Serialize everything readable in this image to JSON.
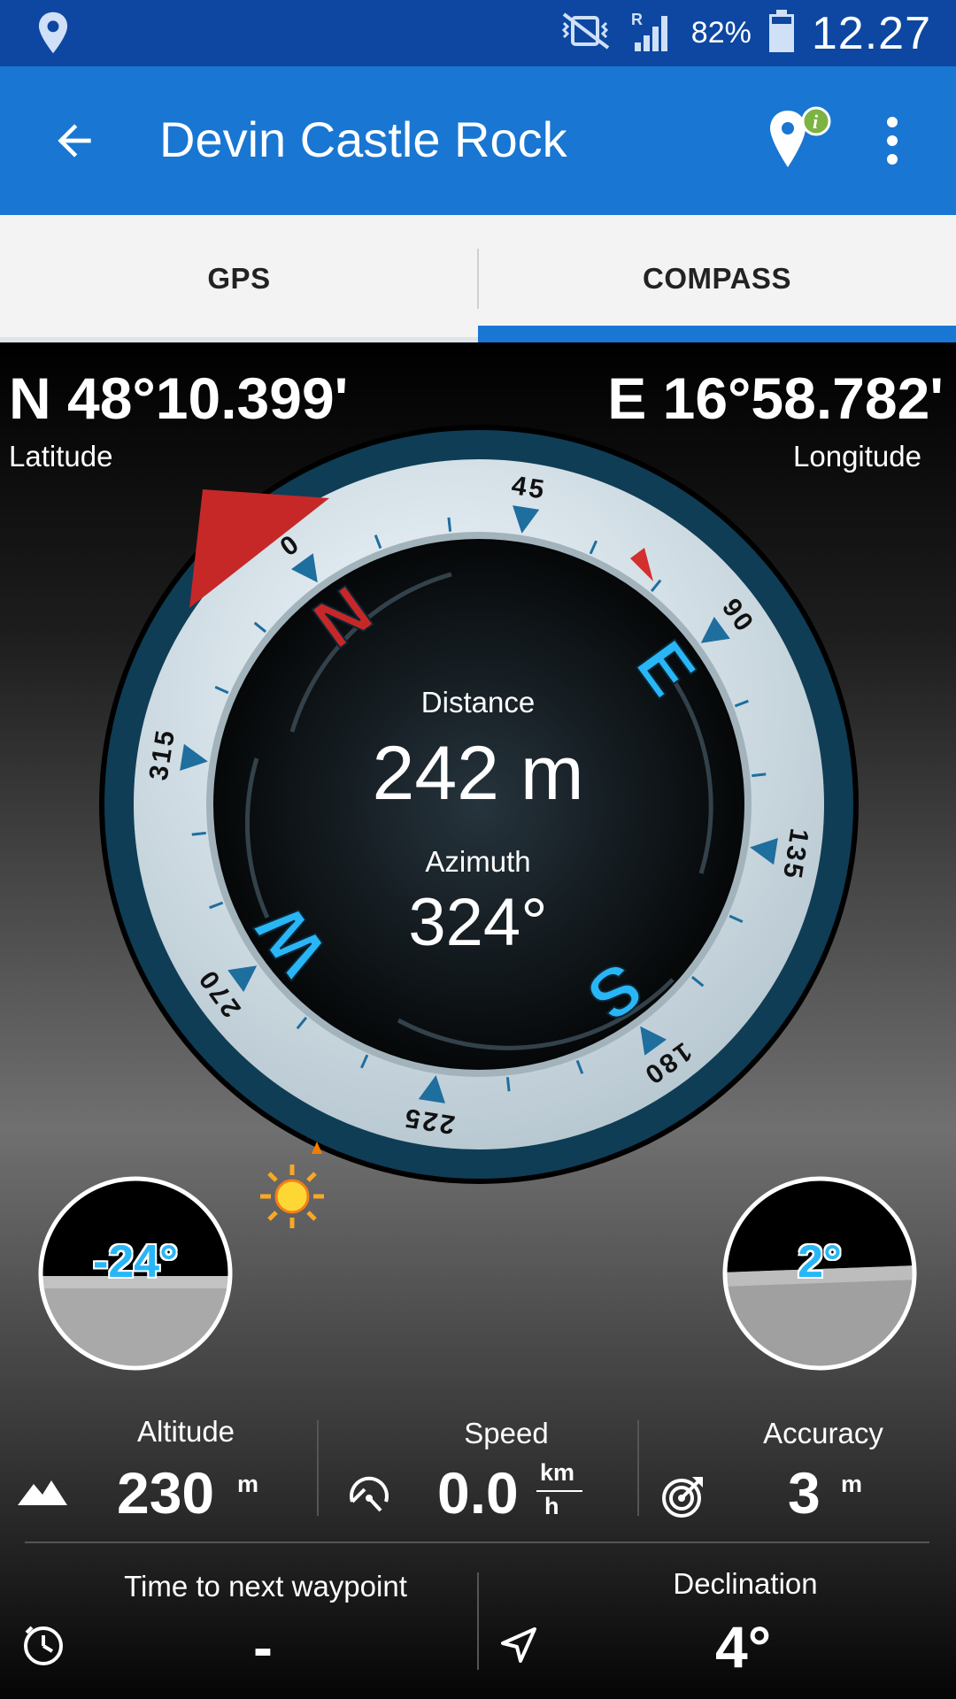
{
  "status_bar": {
    "location_icon": "location-pin-icon",
    "mute_icon": "vibrate-mute-icon",
    "signal_icon": "signal-roaming-icon",
    "battery_percent": "82%",
    "battery_icon": "battery-icon",
    "time": "12.27"
  },
  "toolbar": {
    "back_icon": "arrow-back-icon",
    "title": "Devin Castle Rock",
    "info_icon": "waypoint-info-icon",
    "menu_icon": "more-vert-icon"
  },
  "tabs": [
    {
      "label": "GPS",
      "selected": false
    },
    {
      "label": "COMPASS",
      "selected": true
    }
  ],
  "coords": {
    "latitude_value": "N 48°10.399'",
    "latitude_label": "Latitude",
    "longitude_value": "E 16°58.782'",
    "longitude_label": "Longitude"
  },
  "compass": {
    "distance_label": "Distance",
    "distance_value": "242 m",
    "azimuth_label": "Azimuth",
    "azimuth_value": "324°",
    "cardinals": [
      "N",
      "E",
      "S",
      "W"
    ],
    "degree_labels": [
      "0",
      "45",
      "90",
      "135",
      "180",
      "225",
      "270",
      "315"
    ],
    "sun_icon": "sun-icon"
  },
  "tilt": {
    "left": "-24°",
    "right": "2°"
  },
  "stats": {
    "altitude_label": "Altitude",
    "altitude_value": "230",
    "altitude_unit": "m",
    "altitude_icon": "mountain-icon",
    "speed_label": "Speed",
    "speed_value": "0.0",
    "speed_unit_top": "km",
    "speed_unit_bottom": "h",
    "speed_icon": "speedometer-icon",
    "accuracy_label": "Accuracy",
    "accuracy_value": "3",
    "accuracy_unit": "m",
    "accuracy_icon": "accuracy-target-icon",
    "time_label": "Time to next waypoint",
    "time_value": "-",
    "time_icon": "clock-icon",
    "declination_label": "Declination",
    "declination_value": "4°",
    "declination_icon": "navigation-arrow-icon"
  },
  "colors": {
    "status_bar": "#0d47a1",
    "toolbar": "#1976d2",
    "accent": "#1976d2",
    "cardinal_blue": "#29b6f6",
    "north_red": "#c62828"
  }
}
